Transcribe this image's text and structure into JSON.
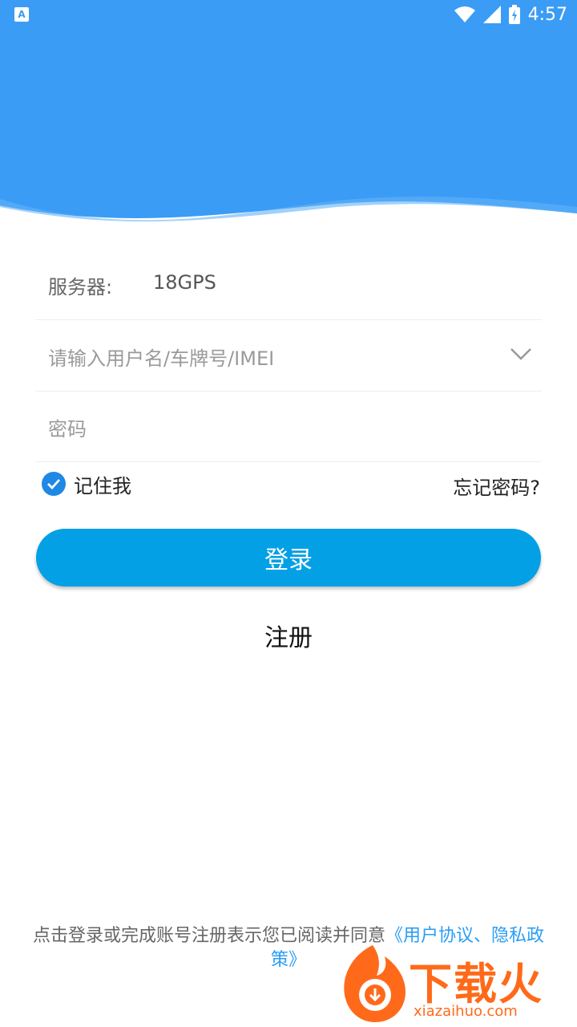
{
  "status_bar": {
    "time": "4:57",
    "app_badge": "A"
  },
  "form": {
    "server_label": "服务器:",
    "server_value": "18GPS",
    "username_placeholder": "请输入用户名/车牌号/IMEI",
    "password_placeholder": "密码"
  },
  "options": {
    "remember_label": "记住我",
    "remember_checked": true,
    "forgot_label": "忘记密码?"
  },
  "actions": {
    "login_label": "登录",
    "register_label": "注册"
  },
  "agreement": {
    "text": "点击登录或完成账号注册表示您已阅读并同意",
    "link": "《用户协议、隐私政策》"
  },
  "watermark": {
    "brand": "下载火",
    "site": "xiazaihuo.com"
  },
  "colors": {
    "header": "#3a9cf5",
    "primary_button": "#03a0e6",
    "link": "#2a9df4"
  }
}
